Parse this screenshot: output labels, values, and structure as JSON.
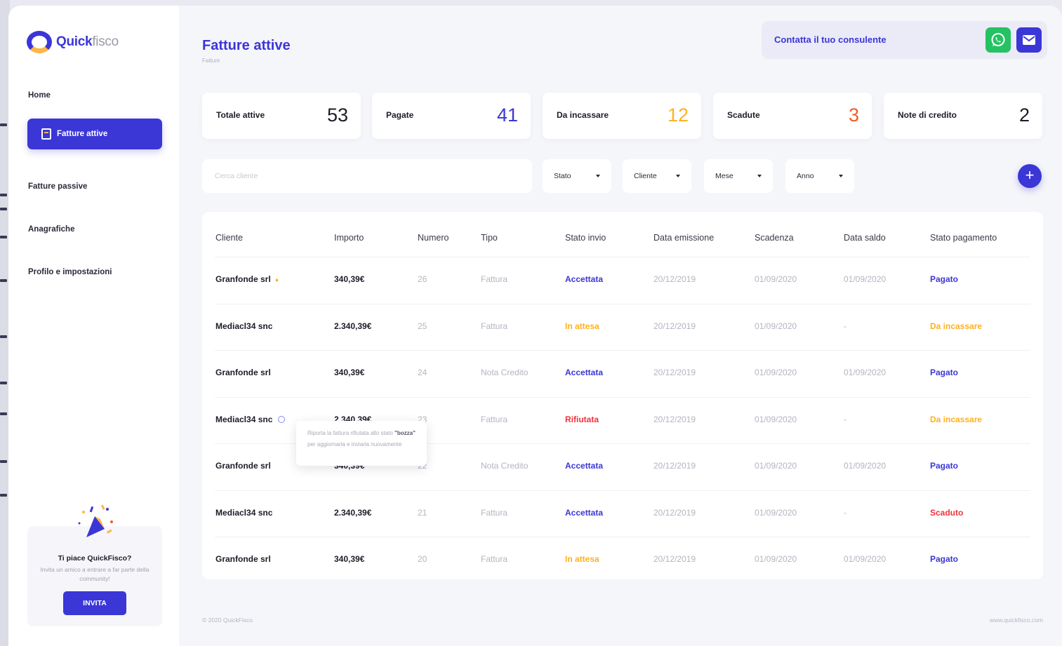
{
  "brand": {
    "name_bold": "Quick",
    "name_light": "fisco"
  },
  "sidebar": {
    "items": [
      {
        "label": "Home"
      },
      {
        "label": "Fatture attive",
        "active": true
      },
      {
        "label": "Fatture passive"
      },
      {
        "label": "Anagrafiche"
      },
      {
        "label": "Profilo e impostazioni"
      }
    ],
    "promo": {
      "title": "Ti piace QuickFisco?",
      "text": "Invita un amico a entrare a far parte della community!",
      "button": "INVITA"
    }
  },
  "header": {
    "title": "Fatture attive",
    "breadcrumb": "Fatture",
    "contact_label": "Contatta il tuo consulente"
  },
  "stats": [
    {
      "label": "Totale attive",
      "value": "53",
      "color": "#1c1c28"
    },
    {
      "label": "Pagate",
      "value": "41",
      "color": "#3b36d6"
    },
    {
      "label": "Da incassare",
      "value": "12",
      "color": "#ffb020"
    },
    {
      "label": "Scadute",
      "value": "3",
      "color": "#f25a2a"
    },
    {
      "label": "Note di credito",
      "value": "2",
      "color": "#1c1c28"
    }
  ],
  "filters": {
    "search_placeholder": "Cerca cliente",
    "selects": [
      "Stato",
      "Cliente",
      "Mese",
      "Anno"
    ],
    "add_label": "+"
  },
  "table": {
    "columns": [
      "Cliente",
      "Importo",
      "Numero",
      "Tipo",
      "Stato invio",
      "Data emissione",
      "Scadenza",
      "Data saldo",
      "Stato pagamento"
    ],
    "rows": [
      {
        "cliente": "Granfonde srl",
        "importo": "340,39€",
        "numero": "26",
        "tipo": "Fattura",
        "stato_invio": "Accettata",
        "emissione": "20/12/2019",
        "scadenza": "01/09/2020",
        "saldo": "01/09/2020",
        "stato_pagamento": "Pagato"
      },
      {
        "cliente": "Mediacl34 snc",
        "importo": "2.340,39€",
        "numero": "25",
        "tipo": "Fattura",
        "stato_invio": "In attesa",
        "emissione": "20/12/2019",
        "scadenza": "01/09/2020",
        "saldo": "-",
        "stato_pagamento": "Da incassare"
      },
      {
        "cliente": "Granfonde srl",
        "importo": "340,39€",
        "numero": "24",
        "tipo": "Nota Credito",
        "stato_invio": "Accettata",
        "emissione": "20/12/2019",
        "scadenza": "01/09/2020",
        "saldo": "01/09/2020",
        "stato_pagamento": "Pagato"
      },
      {
        "cliente": "Mediacl34 snc",
        "importo": "2.340,39€",
        "numero": "23",
        "tipo": "Fattura",
        "stato_invio": "Rifiutata",
        "emissione": "20/12/2019",
        "scadenza": "01/09/2020",
        "saldo": "-",
        "stato_pagamento": "Da incassare"
      },
      {
        "cliente": "Granfonde srl",
        "importo": "340,39€",
        "numero": "22",
        "tipo": "Nota Credito",
        "stato_invio": "Accettata",
        "emissione": "20/12/2019",
        "scadenza": "01/09/2020",
        "saldo": "01/09/2020",
        "stato_pagamento": "Pagato"
      },
      {
        "cliente": "Mediacl34 snc",
        "importo": "2.340,39€",
        "numero": "21",
        "tipo": "Fattura",
        "stato_invio": "Accettata",
        "emissione": "20/12/2019",
        "scadenza": "01/09/2020",
        "saldo": "-",
        "stato_pagamento": "Scaduto"
      },
      {
        "cliente": "Granfonde srl",
        "importo": "340,39€",
        "numero": "20",
        "tipo": "Fattura",
        "stato_invio": "In attesa",
        "emissione": "20/12/2019",
        "scadenza": "01/09/2020",
        "saldo": "01/09/2020",
        "stato_pagamento": "Pagato"
      }
    ],
    "tooltip": {
      "pre": "Riporta la fattura rifiutata allo stato ",
      "bold": "\"bozza\"",
      "post": " per aggiornarla e inviarla nuovamente"
    }
  },
  "status_colors": {
    "Accettata": "#3b36d6",
    "In attesa": "#ffb020",
    "Rifiutata": "#f2333a",
    "Pagato": "#3b36d6",
    "Da incassare": "#ffb020",
    "Scaduto": "#f2333a"
  },
  "footer": {
    "left": "© 2020 QuickFisco",
    "right": "www.quickfisco.com"
  }
}
